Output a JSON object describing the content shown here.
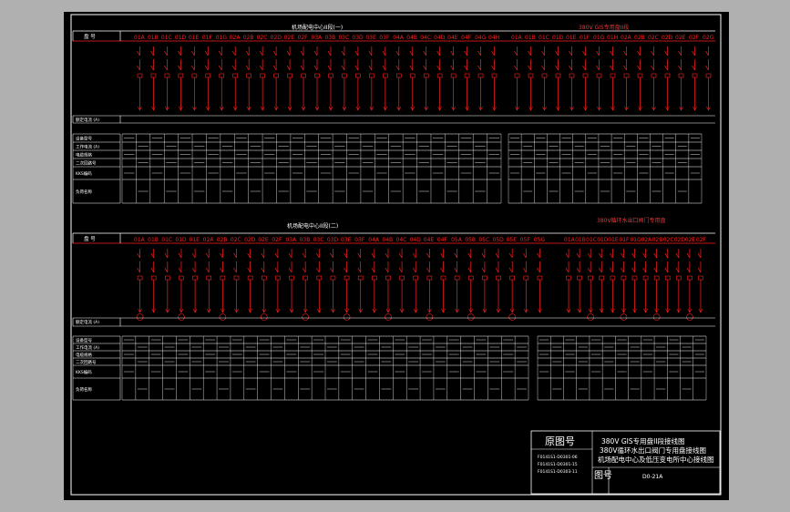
{
  "colors": {
    "background": "#000000",
    "frame": "#b0b0b0",
    "line_white": "#ffffff",
    "line_red": "#ff2020",
    "text_white": "#ffffff",
    "text_red": "#ff3030"
  },
  "section_top": {
    "title_left": "机场配电中心II段(一)",
    "title_right": "380V GIS专用盘II段",
    "row_label_no": "盘 号",
    "row_label_current": "额定电流 (A)",
    "panels_left": [
      "01A",
      "01B",
      "01C",
      "01D",
      "01E",
      "01F",
      "01G",
      "02A",
      "02B",
      "02C",
      "02D",
      "02E",
      "02F",
      "03A",
      "03B",
      "03C",
      "03D",
      "03E",
      "03F",
      "04A",
      "04B",
      "04C",
      "04D",
      "04E",
      "04F",
      "04G",
      "04H"
    ],
    "panels_right": [
      "01A",
      "01B",
      "01C",
      "01D",
      "01E",
      "01F",
      "01G",
      "01H",
      "02A",
      "02B",
      "02C",
      "02D",
      "02E",
      "02F",
      "02G"
    ],
    "row_labels": [
      "设备型号",
      "工作电流 (A)",
      "电缆规格",
      "二次回路号",
      "KKS编码",
      "负荷名称"
    ]
  },
  "section_bottom": {
    "title_left": "机场配电中心II段(二)",
    "title_right": "380V循环水出口阀门专用盘",
    "row_label_no": "盘 号",
    "row_label_current": "额定电流 (A)",
    "panels_left": [
      "01A",
      "01B",
      "01C",
      "01D",
      "01E",
      "02A",
      "02B",
      "02C",
      "02D",
      "02E",
      "02F",
      "03A",
      "03B",
      "03C",
      "03D",
      "03E",
      "03F",
      "04A",
      "04B",
      "04C",
      "04D",
      "04E",
      "04F",
      "05A",
      "05B",
      "05C",
      "05D",
      "05E",
      "05F",
      "05G"
    ],
    "panels_right": [
      "01A",
      "01B",
      "01C",
      "01D",
      "01E",
      "01F",
      "01G",
      "02A",
      "02B",
      "02C",
      "02D",
      "02E",
      "02F"
    ],
    "row_labels": [
      "设备型号",
      "工作电流 (A)",
      "电缆规格",
      "二次回路号",
      "KKS编码",
      "负荷名称"
    ]
  },
  "title_block": {
    "header": "原图号",
    "lines": [
      "380V GIS专用盘II段接线图",
      "380V循环水出口阀门专用盘接线图",
      "机场配电中心及低压变电所中心接线图"
    ],
    "refs": [
      "F0141S1-D0301-06",
      "F0141S1-D0301-15",
      "F0141S1-D0303-11"
    ],
    "fig_label": "图号",
    "fig_no": "D0-21A"
  }
}
